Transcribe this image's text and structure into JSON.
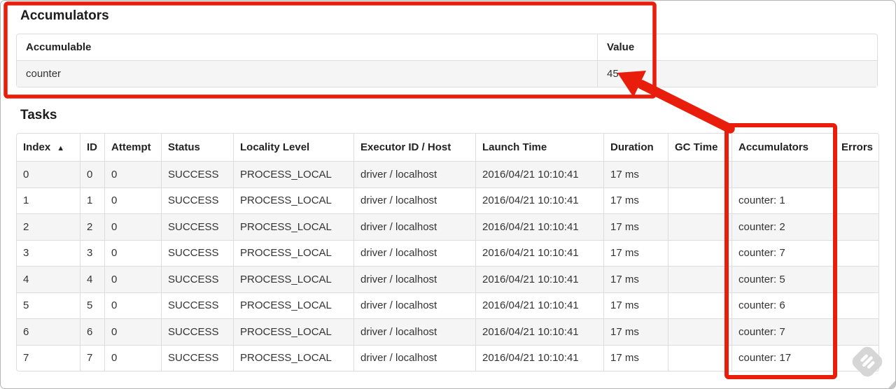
{
  "annotations": {
    "color": "#e81d0b"
  },
  "accumulators_section": {
    "title": "Accumulators",
    "table": {
      "col_accumulable": "Accumulable",
      "col_value": "Value",
      "rows": [
        {
          "accumulable": "counter",
          "value": "45"
        }
      ]
    }
  },
  "tasks_section": {
    "title": "Tasks",
    "sort_icon": "▲",
    "table": {
      "headers": [
        "Index",
        "ID",
        "Attempt",
        "Status",
        "Locality Level",
        "Executor ID / Host",
        "Launch Time",
        "Duration",
        "GC Time",
        "Accumulators",
        "Errors"
      ],
      "rows": [
        {
          "index": "0",
          "id": "0",
          "attempt": "0",
          "status": "SUCCESS",
          "locality": "PROCESS_LOCAL",
          "executor": "driver / localhost",
          "launch": "2016/04/21 10:10:41",
          "duration": "17 ms",
          "gc": "",
          "accumulators": "",
          "errors": ""
        },
        {
          "index": "1",
          "id": "1",
          "attempt": "0",
          "status": "SUCCESS",
          "locality": "PROCESS_LOCAL",
          "executor": "driver / localhost",
          "launch": "2016/04/21 10:10:41",
          "duration": "17 ms",
          "gc": "",
          "accumulators": "counter: 1",
          "errors": ""
        },
        {
          "index": "2",
          "id": "2",
          "attempt": "0",
          "status": "SUCCESS",
          "locality": "PROCESS_LOCAL",
          "executor": "driver / localhost",
          "launch": "2016/04/21 10:10:41",
          "duration": "17 ms",
          "gc": "",
          "accumulators": "counter: 2",
          "errors": ""
        },
        {
          "index": "3",
          "id": "3",
          "attempt": "0",
          "status": "SUCCESS",
          "locality": "PROCESS_LOCAL",
          "executor": "driver / localhost",
          "launch": "2016/04/21 10:10:41",
          "duration": "17 ms",
          "gc": "",
          "accumulators": "counter: 7",
          "errors": ""
        },
        {
          "index": "4",
          "id": "4",
          "attempt": "0",
          "status": "SUCCESS",
          "locality": "PROCESS_LOCAL",
          "executor": "driver / localhost",
          "launch": "2016/04/21 10:10:41",
          "duration": "17 ms",
          "gc": "",
          "accumulators": "counter: 5",
          "errors": ""
        },
        {
          "index": "5",
          "id": "5",
          "attempt": "0",
          "status": "SUCCESS",
          "locality": "PROCESS_LOCAL",
          "executor": "driver / localhost",
          "launch": "2016/04/21 10:10:41",
          "duration": "17 ms",
          "gc": "",
          "accumulators": "counter: 6",
          "errors": ""
        },
        {
          "index": "6",
          "id": "6",
          "attempt": "0",
          "status": "SUCCESS",
          "locality": "PROCESS_LOCAL",
          "executor": "driver / localhost",
          "launch": "2016/04/21 10:10:41",
          "duration": "17 ms",
          "gc": "",
          "accumulators": "counter: 7",
          "errors": ""
        },
        {
          "index": "7",
          "id": "7",
          "attempt": "0",
          "status": "SUCCESS",
          "locality": "PROCESS_LOCAL",
          "executor": "driver / localhost",
          "launch": "2016/04/21 10:10:41",
          "duration": "17 ms",
          "gc": "",
          "accumulators": "counter: 17",
          "errors": ""
        }
      ]
    }
  }
}
